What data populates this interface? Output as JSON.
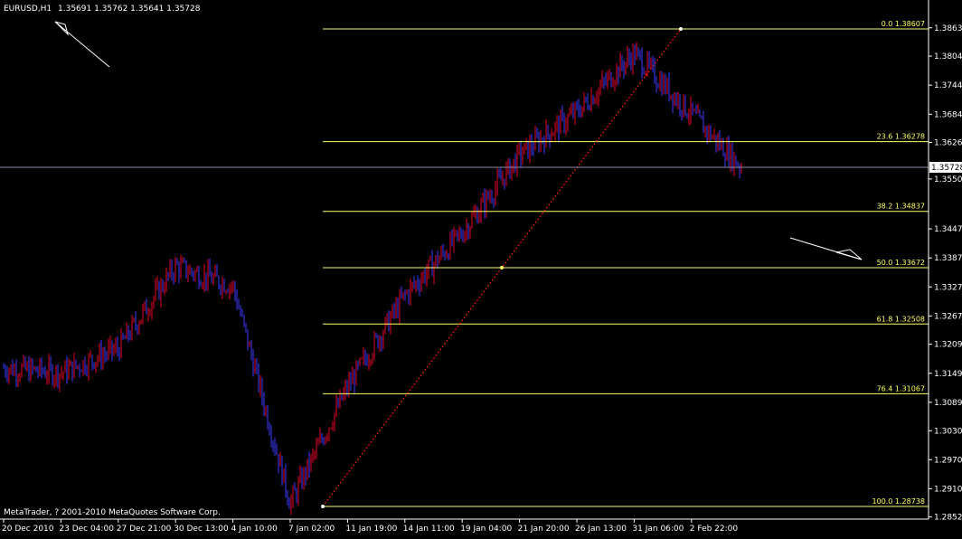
{
  "header": {
    "symbol": "EURUSD,H1",
    "ohlc": "1.35691 1.35762 1.35641 1.35728"
  },
  "footer": {
    "copyright": "MetaTrader, ? 2001-2010 MetaQuotes Software Corp."
  },
  "colors": {
    "background": "#000000",
    "up_bar": "#e8002a",
    "down_bar": "#3b3bff",
    "fib_level": "#ffff66",
    "fib_trend": "#ff2a00",
    "current_price_line": "#8a8aaa",
    "axis": "#ffffff"
  },
  "chart_data": {
    "type": "line",
    "title": "EURUSD,H1",
    "xlabel": "",
    "ylabel": "",
    "ylim": [
      1.2852,
      1.3876
    ],
    "grid": false,
    "price_ticks": [
      "1.38630",
      "1.38045",
      "1.37445",
      "1.36845",
      "1.36260",
      "1.35506",
      "1.34475",
      "1.33875",
      "1.33275",
      "1.32675",
      "1.32090",
      "1.31490",
      "1.30890",
      "1.30303",
      "1.29705",
      "1.29105",
      "1.28520"
    ],
    "time_ticks": [
      "20 Dec 2010",
      "23 Dec 04:00",
      "27 Dec 21:00",
      "30 Dec 13:00",
      "4 Jan 10:00",
      "7 Jan 02:00",
      "11 Jan 19:00",
      "14 Jan 11:00",
      "19 Jan 04:00",
      "21 Jan 20:00",
      "26 Jan 13:00",
      "31 Jan 06:00",
      "2 Feb 22:00"
    ],
    "current_price": "1.35728",
    "fibonacci": [
      {
        "level": "0.0",
        "price": "1.38607"
      },
      {
        "level": "23.6",
        "price": "1.36278"
      },
      {
        "level": "38.2",
        "price": "1.34837"
      },
      {
        "level": "50.0",
        "price": "1.33672"
      },
      {
        "level": "61.8",
        "price": "1.32508"
      },
      {
        "level": "76.4",
        "price": "1.31067"
      },
      {
        "level": "100.0",
        "price": "1.28738"
      }
    ],
    "series": [
      {
        "x": [
          "20 Dec 2010",
          "23 Dec 04:00",
          "27 Dec 21:00",
          "30 Dec 13:00",
          "4 Jan 10:00",
          "7 Jan 02:00",
          "11 Jan 19:00",
          "14 Jan 11:00",
          "19 Jan 04:00",
          "21 Jan 20:00",
          "26 Jan 13:00",
          "31 Jan 06:00",
          "2 Feb 22:00"
        ],
        "values": [
          1.316,
          1.315,
          1.32,
          1.337,
          1.333,
          1.288,
          1.312,
          1.331,
          1.344,
          1.36,
          1.369,
          1.381,
          1.3575
        ]
      }
    ]
  }
}
